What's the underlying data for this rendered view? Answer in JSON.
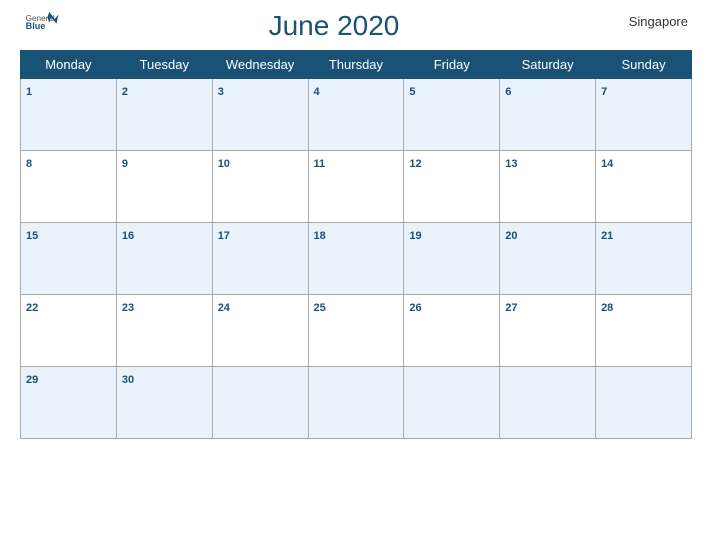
{
  "header": {
    "title": "June 2020",
    "region": "Singapore",
    "logo_general": "General",
    "logo_blue": "Blue"
  },
  "days": [
    "Monday",
    "Tuesday",
    "Wednesday",
    "Thursday",
    "Friday",
    "Saturday",
    "Sunday"
  ],
  "weeks": [
    [
      {
        "num": "1",
        "empty": false
      },
      {
        "num": "2",
        "empty": false
      },
      {
        "num": "3",
        "empty": false
      },
      {
        "num": "4",
        "empty": false
      },
      {
        "num": "5",
        "empty": false
      },
      {
        "num": "6",
        "empty": false
      },
      {
        "num": "7",
        "empty": false
      }
    ],
    [
      {
        "num": "8",
        "empty": false
      },
      {
        "num": "9",
        "empty": false
      },
      {
        "num": "10",
        "empty": false
      },
      {
        "num": "11",
        "empty": false
      },
      {
        "num": "12",
        "empty": false
      },
      {
        "num": "13",
        "empty": false
      },
      {
        "num": "14",
        "empty": false
      }
    ],
    [
      {
        "num": "15",
        "empty": false
      },
      {
        "num": "16",
        "empty": false
      },
      {
        "num": "17",
        "empty": false
      },
      {
        "num": "18",
        "empty": false
      },
      {
        "num": "19",
        "empty": false
      },
      {
        "num": "20",
        "empty": false
      },
      {
        "num": "21",
        "empty": false
      }
    ],
    [
      {
        "num": "22",
        "empty": false
      },
      {
        "num": "23",
        "empty": false
      },
      {
        "num": "24",
        "empty": false
      },
      {
        "num": "25",
        "empty": false
      },
      {
        "num": "26",
        "empty": false
      },
      {
        "num": "27",
        "empty": false
      },
      {
        "num": "28",
        "empty": false
      }
    ],
    [
      {
        "num": "29",
        "empty": false
      },
      {
        "num": "30",
        "empty": false
      },
      {
        "num": "",
        "empty": true
      },
      {
        "num": "",
        "empty": true
      },
      {
        "num": "",
        "empty": true
      },
      {
        "num": "",
        "empty": true
      },
      {
        "num": "",
        "empty": true
      }
    ]
  ]
}
